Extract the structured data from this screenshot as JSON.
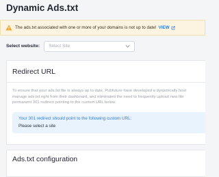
{
  "page": {
    "title": "Dynamic Ads.txt"
  },
  "alert": {
    "message": "The ads.txt associated with one or more of your domains is not up to date!",
    "link_label": "VIEW",
    "colors": {
      "background": "#fdf3e1",
      "icon": "#f0a52b",
      "link": "#2f7de1"
    },
    "icons": {
      "warning": "warning-icon",
      "link": "external-link-icon"
    }
  },
  "website_select": {
    "label": "Select website:",
    "placeholder": "Select Site",
    "icon": "chevron-down-icon"
  },
  "redirect_card": {
    "title": "Redirect URL",
    "description_lines": [
      "To ensure that your ads.txt file is always up to date, Pubfuture have developed a dynamically host",
      "manage ads.txt right from their dashboard, and eliminated the need to frequently upload new file",
      "permanent 301 redirect pointing to the custom URL below."
    ],
    "info_title": "Your 301 redirect should point to the following custom URL:",
    "info_value": "Please select a site",
    "colors": {
      "info_background": "#e9f3fd",
      "info_title": "#2f7de1"
    }
  },
  "config_card": {
    "title": "Ads.txt configuration"
  }
}
